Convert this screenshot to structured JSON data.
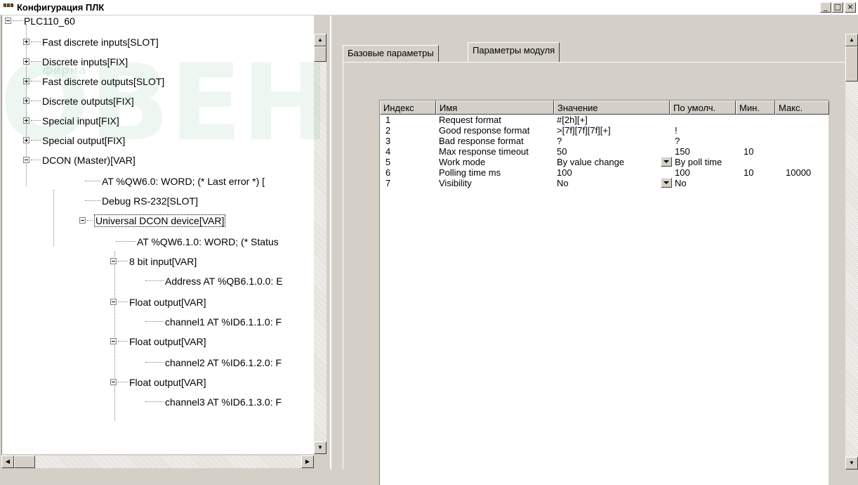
{
  "window": {
    "title": "Конфигурация ПЛК",
    "minimize": "_",
    "maximize": "□",
    "close": "×"
  },
  "tree": {
    "root": "PLC110_60",
    "items": [
      "Fast discrete inputs[SLOT]",
      "Discrete inputs[FIX]",
      "Fast discrete outputs[SLOT]",
      "Discrete outputs[FIX]",
      "Special input[FIX]",
      "Special output[FIX]",
      "DCON (Master)[VAR]",
      "AT %QW6.0: WORD; (* Last error *) [",
      "Debug RS-232[SLOT]",
      "Universal DCON device[VAR]",
      "AT %QW6.1.0: WORD; (* Status",
      "8 bit input[VAR]",
      "Address AT %QB6.1.0.0: E",
      "Float output[VAR]",
      "channel1 AT %ID6.1.1.0: F",
      "Float output[VAR]",
      "channel2 AT %ID6.1.2.0: F",
      "Float output[VAR]",
      "channel3 AT %ID6.1.3.0: F"
    ]
  },
  "tabs": [
    {
      "label": "Базовые параметры"
    },
    {
      "label": "Параметры модуля"
    }
  ],
  "grid": {
    "columns": [
      "Индекс",
      "Имя",
      "Значение",
      "По умолч.",
      "Мин.",
      "Макс."
    ],
    "rows": [
      {
        "index": "1",
        "name": "Request format",
        "value": "#[2h][+]",
        "default": "",
        "min": "",
        "max": ""
      },
      {
        "index": "2",
        "name": "Good response format",
        "value": ">[7f][7f][7f][+]",
        "default": "!",
        "min": "",
        "max": ""
      },
      {
        "index": "3",
        "name": "Bad response format",
        "value": "?",
        "default": "?",
        "min": "",
        "max": ""
      },
      {
        "index": "4",
        "name": "Max response timeout",
        "value": "50",
        "default": "150",
        "min": "10",
        "max": ""
      },
      {
        "index": "5",
        "name": "Work mode",
        "value": "By value change",
        "default": "By poll time",
        "min": "",
        "max": ""
      },
      {
        "index": "6",
        "name": "Polling time ms",
        "value": "100",
        "default": "100",
        "min": "10",
        "max": "10000"
      },
      {
        "index": "7",
        "name": "Visibility",
        "value": "No",
        "default": "No",
        "min": "",
        "max": ""
      }
    ]
  },
  "watermark": {
    "text1": "ОВЕН",
    "text2": "фирма"
  }
}
